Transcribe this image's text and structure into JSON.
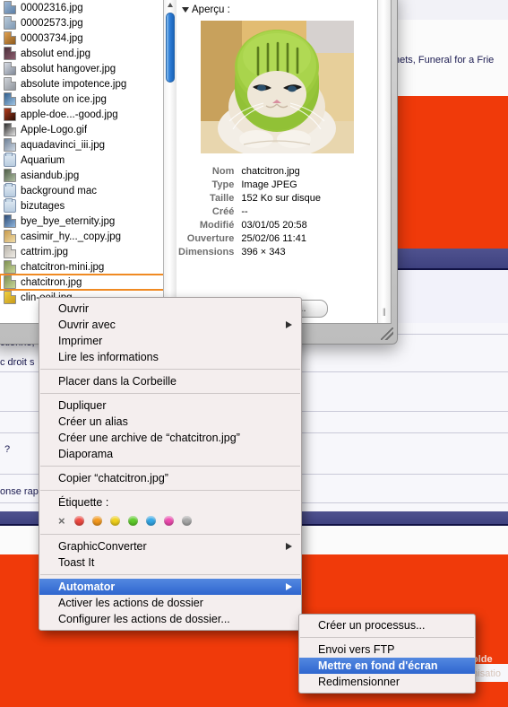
{
  "window": {
    "title_bar_style": "aqua-brushed",
    "preview_header": "Aperçu :",
    "more_info_button": "Plus d'infos...",
    "disclosure_icon": "triangle-down-icon",
    "resize_icon": "resize-grip-icon"
  },
  "file_list": [
    {
      "name": "00002316.jpg",
      "icon": "image-file-icon",
      "type": "file",
      "selected": false
    },
    {
      "name": "00002573.jpg",
      "icon": "image-file-icon",
      "type": "file",
      "selected": false
    },
    {
      "name": "00003734.jpg",
      "icon": "image-file-icon",
      "type": "file",
      "selected": false
    },
    {
      "name": "absolut end.jpg",
      "icon": "image-file-icon",
      "type": "file",
      "selected": false
    },
    {
      "name": "absolut hangover.jpg",
      "icon": "image-file-icon",
      "type": "file",
      "selected": false
    },
    {
      "name": "absolute impotence.jpg",
      "icon": "image-file-icon",
      "type": "file",
      "selected": false
    },
    {
      "name": "absolute on ice.jpg",
      "icon": "image-file-icon",
      "type": "file",
      "selected": false
    },
    {
      "name": "apple-doe...-good.jpg",
      "icon": "image-file-icon",
      "type": "file",
      "selected": false
    },
    {
      "name": "Apple-Logo.gif",
      "icon": "image-file-icon",
      "type": "file",
      "selected": false
    },
    {
      "name": "aquadavinci_iii.jpg",
      "icon": "image-file-icon",
      "type": "file",
      "selected": false
    },
    {
      "name": "Aquarium",
      "icon": "folder-icon",
      "type": "folder",
      "selected": false
    },
    {
      "name": "asiandub.jpg",
      "icon": "image-file-icon",
      "type": "file",
      "selected": false
    },
    {
      "name": "background mac",
      "icon": "folder-icon",
      "type": "folder",
      "selected": false
    },
    {
      "name": "bizutages",
      "icon": "folder-icon",
      "type": "folder",
      "selected": false
    },
    {
      "name": "bye_bye_eternity.jpg",
      "icon": "image-file-icon",
      "type": "file",
      "selected": false
    },
    {
      "name": "casimir_hy..._copy.jpg",
      "icon": "image-file-icon",
      "type": "file",
      "selected": false
    },
    {
      "name": "cattrim.jpg",
      "icon": "image-file-icon",
      "type": "file",
      "selected": false
    },
    {
      "name": "chatcitron-mini.jpg",
      "icon": "image-file-icon",
      "type": "file",
      "selected": false
    },
    {
      "name": "chatcitron.jpg",
      "icon": "image-file-icon",
      "type": "file",
      "selected": true
    },
    {
      "name": "clin-oeil.jpg",
      "icon": "image-file-icon",
      "type": "file",
      "selected": false
    }
  ],
  "preview": {
    "image_alt": "cat wearing a lime rind helmet",
    "fields": [
      {
        "key": "Nom",
        "value": "chatcitron.jpg"
      },
      {
        "key": "Type",
        "value": "Image JPEG"
      },
      {
        "key": "Taille",
        "value": "152 Ko sur disque"
      },
      {
        "key": "Créé",
        "value": "--"
      },
      {
        "key": "Modifié",
        "value": "03/01/05 20:58"
      },
      {
        "key": "Ouverture",
        "value": "25/02/06 11:41"
      },
      {
        "key": "Dimensions",
        "value": "396 × 343"
      }
    ]
  },
  "context_menu": {
    "groups": [
      {
        "items": [
          {
            "label": "Ouvrir",
            "submenu": false,
            "highlighted": false
          },
          {
            "label": "Ouvrir avec",
            "submenu": true,
            "highlighted": false
          },
          {
            "label": "Imprimer",
            "submenu": false,
            "highlighted": false
          },
          {
            "label": "Lire les informations",
            "submenu": false,
            "highlighted": false
          }
        ]
      },
      {
        "items": [
          {
            "label": "Placer dans la Corbeille",
            "submenu": false,
            "highlighted": false
          }
        ]
      },
      {
        "items": [
          {
            "label": "Dupliquer",
            "submenu": false,
            "highlighted": false
          },
          {
            "label": "Créer un alias",
            "submenu": false,
            "highlighted": false
          },
          {
            "label": "Créer une archive de “chatcitron.jpg”",
            "submenu": false,
            "highlighted": false
          },
          {
            "label": "Diaporama",
            "submenu": false,
            "highlighted": false
          }
        ]
      },
      {
        "items": [
          {
            "label": "Copier “chatcitron.jpg”",
            "submenu": false,
            "highlighted": false
          }
        ]
      }
    ],
    "label_section": {
      "title": "Étiquette :",
      "none_glyph": "×",
      "colors": [
        "#f04a42",
        "#f59a1e",
        "#f2d21c",
        "#5fcd2b",
        "#33a8e8",
        "#ef4bb0",
        "#a8a8a8"
      ]
    },
    "bottom_groups": [
      {
        "items": [
          {
            "label": "GraphicConverter",
            "submenu": true,
            "highlighted": false
          },
          {
            "label": "Toast It",
            "submenu": false,
            "highlighted": false
          }
        ]
      },
      {
        "items": [
          {
            "label": "Automator",
            "submenu": true,
            "highlighted": true
          },
          {
            "label": "Activer les actions de dossier",
            "submenu": false,
            "highlighted": false
          },
          {
            "label": "Configurer les actions de dossier...",
            "submenu": false,
            "highlighted": false
          }
        ]
      }
    ]
  },
  "submenu": {
    "groups": [
      {
        "items": [
          {
            "label": "Créer un processus...",
            "highlighted": false
          }
        ]
      },
      {
        "items": [
          {
            "label": "Envoi vers FTP",
            "highlighted": false
          },
          {
            "label": "Mettre en fond d'écran",
            "highlighted": true
          },
          {
            "label": "Redimensionner",
            "highlighted": false
          }
        ]
      }
    ]
  },
  "background": {
    "top_text": "nets, Funeral for a Frie",
    "left_text_1": "ctionné,",
    "left_text_2": "c droit s",
    "left_text_3": "?",
    "left_text_4": "onse rap",
    "right_faint_1": "olde",
    "right_faint_2": "omisatio",
    "orange": "#f03a0a",
    "blue_band": "#474a8c",
    "lavender": "#f2f2fa"
  }
}
